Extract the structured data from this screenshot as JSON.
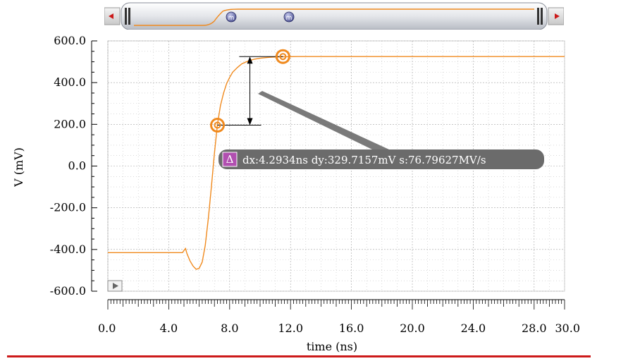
{
  "colors": {
    "trace": "#f08a1e",
    "grid": "#9a9a9a",
    "marker": "#f08a1e",
    "delta_bg": "#6b6b6b",
    "delta_icon": "#b14fb0",
    "bottom_rule": "#cc1a1a"
  },
  "scroller": {
    "left_arrow_icon": "triangle-left-icon",
    "right_arrow_icon": "triangle-right-icon",
    "marker_label_1": "m",
    "marker_label_2": "m"
  },
  "delta": {
    "icon_text": "Δ",
    "label": "dx:4.2934ns dy:329.7157mV s:76.79627MV/s"
  },
  "play_icon": "play-icon",
  "chart_data": {
    "type": "line",
    "title": "",
    "xlabel": "time (ns)",
    "ylabel": "V (mV)",
    "xlim": [
      0,
      30
    ],
    "ylim": [
      -600,
      600
    ],
    "x_ticks": [
      0,
      4,
      8,
      12,
      16,
      20,
      24,
      28,
      30
    ],
    "x_tick_labels": [
      "0.0",
      "4.0",
      "8.0",
      "12.0",
      "16.0",
      "20.0",
      "24.0",
      "28.0",
      "30.0"
    ],
    "y_ticks": [
      600,
      400,
      200,
      0,
      -200,
      -400,
      -600
    ],
    "y_tick_labels": [
      "600.0",
      "400.0",
      "200.0",
      "0.0",
      "-200.0",
      "-400.0",
      "-600.0"
    ],
    "grid": true,
    "series": [
      {
        "x": [
          0,
          4.9,
          5.0,
          5.1,
          5.2,
          5.4,
          5.6,
          5.8,
          6.0,
          6.2,
          6.4,
          6.6,
          6.8,
          7.0,
          7.2,
          7.4,
          7.6,
          7.8,
          8.0,
          8.2,
          8.5,
          8.8,
          9.2,
          9.6,
          10.0,
          10.5,
          11.0,
          11.5,
          12.5,
          14,
          18,
          22,
          26,
          30
        ],
        "y": [
          -415,
          -415,
          -405,
          -395,
          -420,
          -455,
          -480,
          -495,
          -490,
          -460,
          -380,
          -250,
          -100,
          60,
          200,
          290,
          350,
          395,
          425,
          450,
          472,
          490,
          503,
          512,
          517,
          521,
          523,
          524,
          525,
          525,
          525,
          525,
          525,
          525
        ]
      }
    ],
    "markers": [
      {
        "x": 7.2,
        "y": 196
      },
      {
        "x": 11.5,
        "y": 525
      }
    ]
  }
}
